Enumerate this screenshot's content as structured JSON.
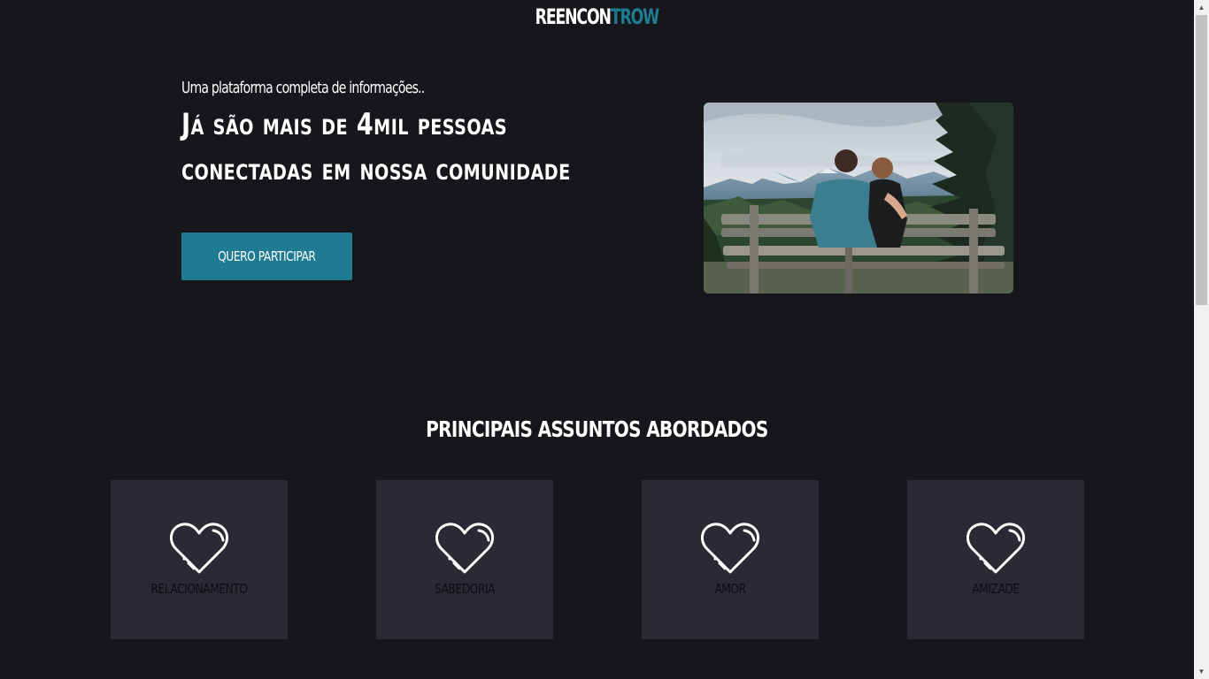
{
  "header": {
    "logo_part1": "REENCON",
    "logo_part2": "TROW"
  },
  "hero": {
    "kicker": "Uma plataforma completa de informações..",
    "title_line1": "Já são mais de 4mil pessoas",
    "title_line2": "conectadas em nossa comunidade",
    "cta_label": "QUERO PARTICIPAR"
  },
  "topics": {
    "title": "PRINCIPAIS ASSUNTOS ABORDADOS",
    "items": [
      {
        "label": "RELACIONAMENTO",
        "icon": "heart-icon"
      },
      {
        "label": "SABEDORIA",
        "icon": "heart-icon"
      },
      {
        "label": "AMOR",
        "icon": "heart-icon"
      },
      {
        "label": "AMIZADE",
        "icon": "heart-icon"
      }
    ]
  },
  "colors": {
    "background": "#16161b",
    "accent": "#1e7b91",
    "card": "#292a34"
  }
}
